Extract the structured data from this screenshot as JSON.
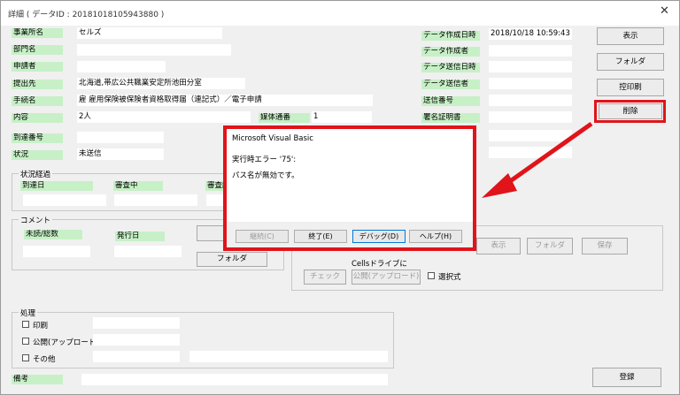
{
  "window": {
    "title": "詳細 ( データID : 20181018105943880 )",
    "close": "✕"
  },
  "left": {
    "office_label": "事業所名",
    "office_value": "セルズ",
    "dept_label": "部門名",
    "applicant_label": "申請者",
    "dest_label": "提出先",
    "dest_value": "北海道,帯広公共職業安定所池田分室",
    "proc_label": "手続名",
    "proc_value": "雇 雇用保険被保険者資格取得届（連記式）／電子申請",
    "content_label": "内容",
    "content_value": "2人",
    "media_label": "媒体通番",
    "media_value": "1",
    "arrival_label": "到達番号",
    "status_label": "状況",
    "status_value": "未送信"
  },
  "right": {
    "created_label": "データ作成日時",
    "created_value": "2018/10/18 10:59:43",
    "creator_label": "データ作成者",
    "sent_at_label": "データ送信日時",
    "sender_label": "データ送信者",
    "send_no_label": "送信番号",
    "cert_label": "署名証明書"
  },
  "buttons": {
    "show": "表示",
    "folder": "フォルダ",
    "print_copy": "控印刷",
    "delete": "削除",
    "register": "登録"
  },
  "progress": {
    "title": "状況経過",
    "arrival": "到達日",
    "reviewing": "審査中",
    "reviewed": "審査終"
  },
  "comment": {
    "title": "コメント",
    "unread": "未読/総数",
    "issue_date": "発行日",
    "folder": "フォルダ"
  },
  "publish": {
    "show": "表示",
    "folder": "フォルダ",
    "save": "保存",
    "cells_drive": "Cellsドライブに",
    "check": "チェック",
    "public_upload": "公開(アップロード)",
    "select": "選択式"
  },
  "processing": {
    "title": "処理",
    "print": "印刷",
    "public_upload": "公開(アップロード)",
    "other": "その他"
  },
  "remarks_label": "備考",
  "dialog": {
    "title": "Microsoft Visual Basic",
    "error": "実行時エラー '75':",
    "message": "パス名が無効です。",
    "continue": "継続(C)",
    "end": "終了(E)",
    "debug": "デバッグ(D)",
    "help": "ヘルプ(H)"
  },
  "colors": {
    "label_bg": "#c7f0c7",
    "highlight": "#e0141a"
  }
}
